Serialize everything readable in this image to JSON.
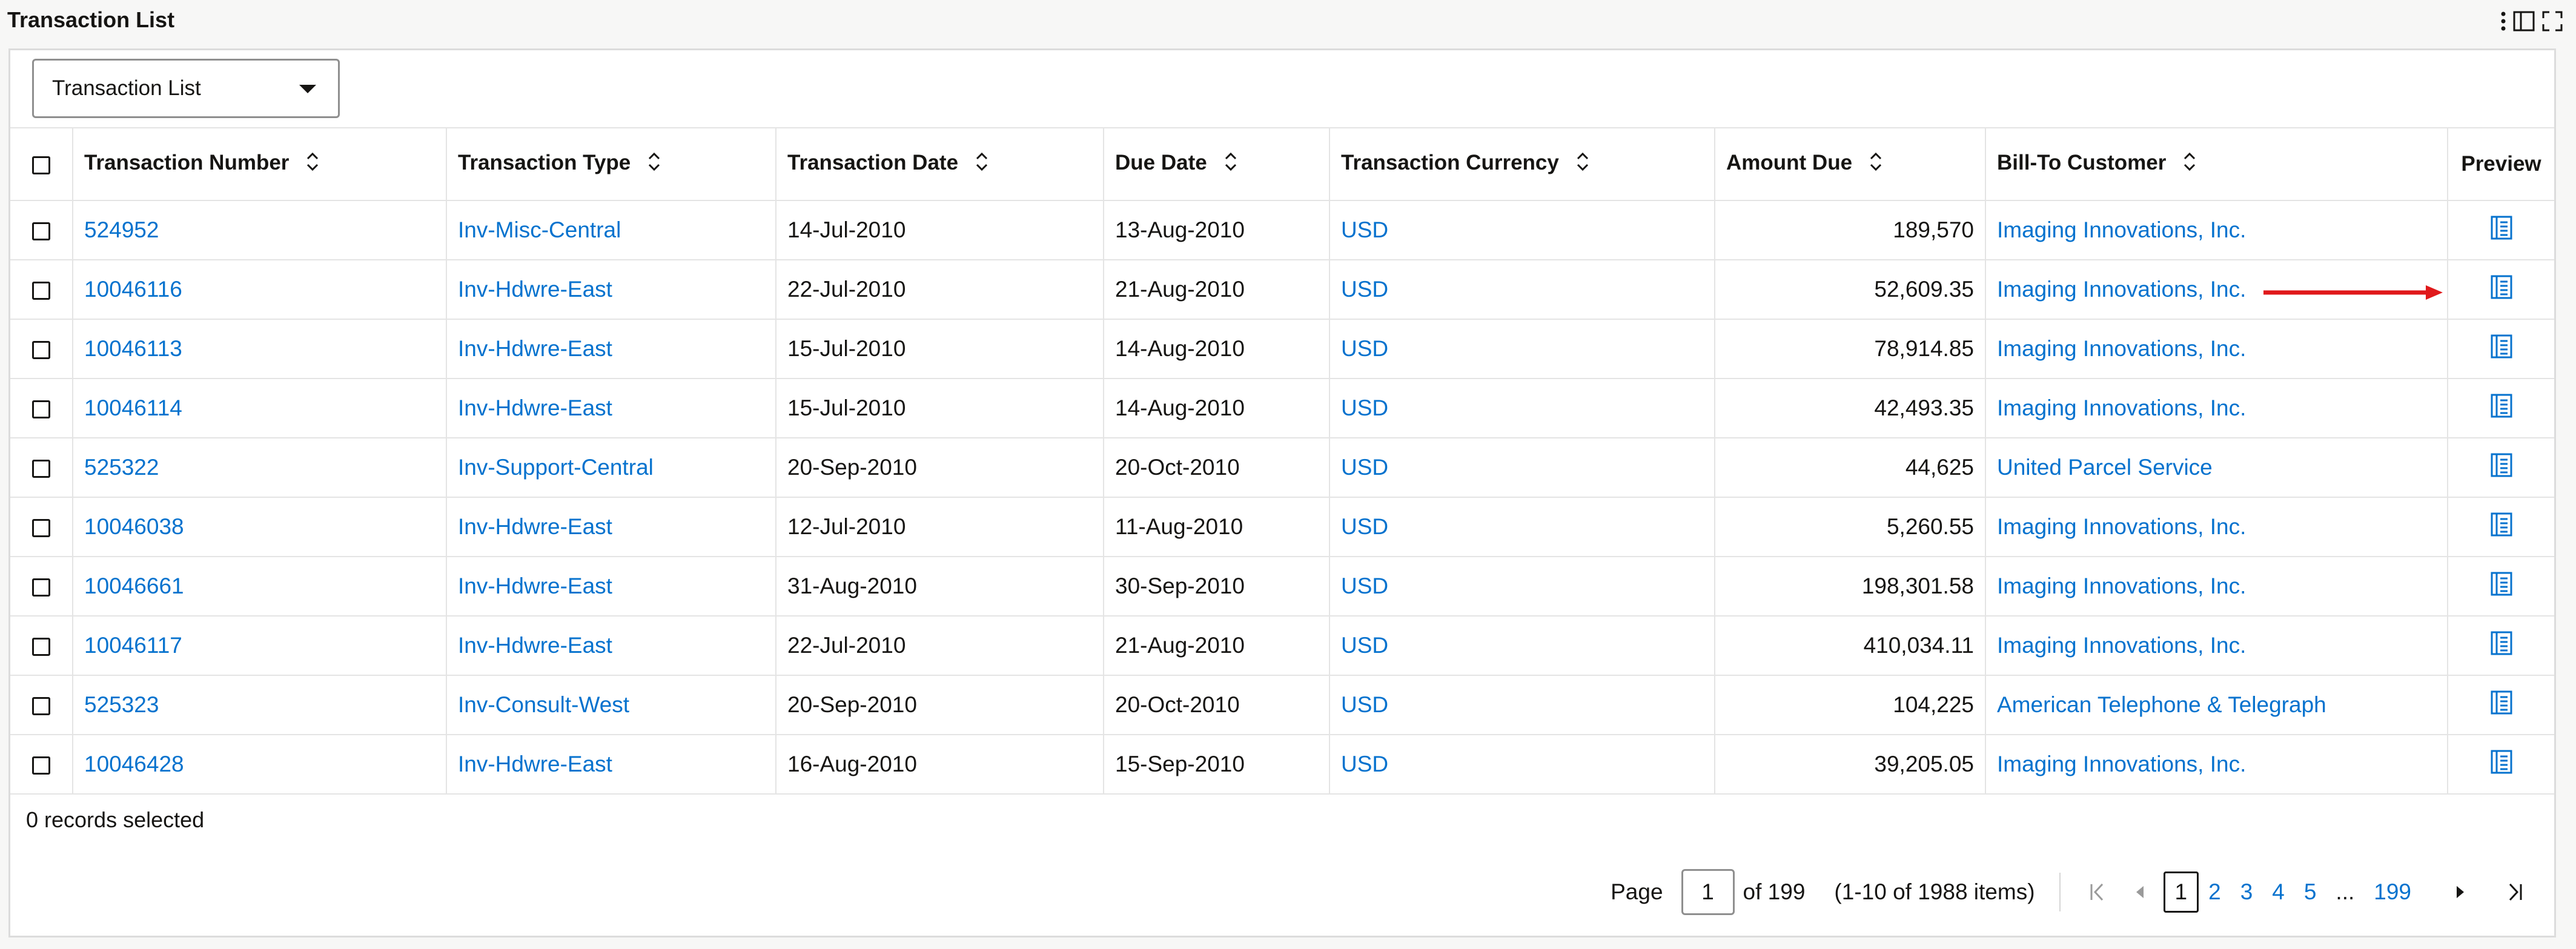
{
  "page": {
    "title": "Transaction List"
  },
  "icons": {
    "more": "more-vertical-icon",
    "panel": "panel-toggle-icon",
    "fullscreen": "fullscreen-icon",
    "sort": "sort-updown-icon",
    "preview": "preview-document-icon",
    "first": "first-page-icon",
    "prev": "previous-page-icon",
    "next": "next-page-icon",
    "last": "last-page-icon"
  },
  "colors": {
    "link": "#0572ce",
    "annotation": "#e0191b",
    "text": "#161513"
  },
  "view_selector": {
    "value": "Transaction List"
  },
  "table": {
    "columns": [
      {
        "label": "Transaction Number"
      },
      {
        "label": "Transaction Type"
      },
      {
        "label": "Transaction Date"
      },
      {
        "label": "Due Date"
      },
      {
        "label": "Transaction Currency"
      },
      {
        "label": "Amount Due"
      },
      {
        "label": "Bill-To Customer"
      },
      {
        "label": "Preview"
      }
    ],
    "rows": [
      {
        "number": "524952",
        "type": "Inv-Misc-Central",
        "date": "14-Jul-2010",
        "due": "13-Aug-2010",
        "currency": "USD",
        "amount": "189,570",
        "customer": "Imaging Innovations, Inc."
      },
      {
        "number": "10046116",
        "type": "Inv-Hdwre-East",
        "date": "22-Jul-2010",
        "due": "21-Aug-2010",
        "currency": "USD",
        "amount": "52,609.35",
        "customer": "Imaging Innovations, Inc."
      },
      {
        "number": "10046113",
        "type": "Inv-Hdwre-East",
        "date": "15-Jul-2010",
        "due": "14-Aug-2010",
        "currency": "USD",
        "amount": "78,914.85",
        "customer": "Imaging Innovations, Inc."
      },
      {
        "number": "10046114",
        "type": "Inv-Hdwre-East",
        "date": "15-Jul-2010",
        "due": "14-Aug-2010",
        "currency": "USD",
        "amount": "42,493.35",
        "customer": "Imaging Innovations, Inc."
      },
      {
        "number": "525322",
        "type": "Inv-Support-Central",
        "date": "20-Sep-2010",
        "due": "20-Oct-2010",
        "currency": "USD",
        "amount": "44,625",
        "customer": "United Parcel Service"
      },
      {
        "number": "10046038",
        "type": "Inv-Hdwre-East",
        "date": "12-Jul-2010",
        "due": "11-Aug-2010",
        "currency": "USD",
        "amount": "5,260.55",
        "customer": "Imaging Innovations, Inc."
      },
      {
        "number": "10046661",
        "type": "Inv-Hdwre-East",
        "date": "31-Aug-2010",
        "due": "30-Sep-2010",
        "currency": "USD",
        "amount": "198,301.58",
        "customer": "Imaging Innovations, Inc."
      },
      {
        "number": "10046117",
        "type": "Inv-Hdwre-East",
        "date": "22-Jul-2010",
        "due": "21-Aug-2010",
        "currency": "USD",
        "amount": "410,034.11",
        "customer": "Imaging Innovations, Inc."
      },
      {
        "number": "525323",
        "type": "Inv-Consult-West",
        "date": "20-Sep-2010",
        "due": "20-Oct-2010",
        "currency": "USD",
        "amount": "104,225",
        "customer": "American Telephone & Telegraph"
      },
      {
        "number": "10046428",
        "type": "Inv-Hdwre-East",
        "date": "16-Aug-2010",
        "due": "15-Sep-2010",
        "currency": "USD",
        "amount": "39,205.05",
        "customer": "Imaging Innovations, Inc."
      }
    ]
  },
  "footer": {
    "records_selected": "0 records selected"
  },
  "pagination": {
    "page_label": "Page",
    "current_page": "1",
    "of_label": "of 199",
    "items_summary": "(1-10 of 1988 items)",
    "pages": [
      "1",
      "2",
      "3",
      "4",
      "5"
    ],
    "ellipsis": "...",
    "last_page": "199"
  }
}
